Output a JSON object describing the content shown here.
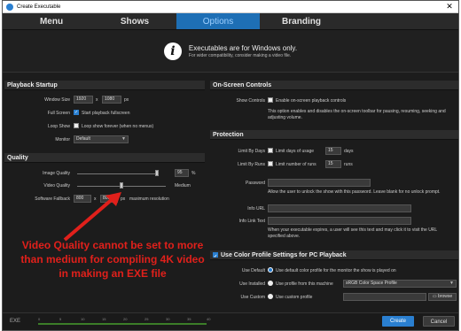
{
  "window": {
    "title": "Create Executable",
    "close": "✕"
  },
  "tabs": [
    {
      "label": "Menu",
      "active": false
    },
    {
      "label": "Shows",
      "active": false
    },
    {
      "label": "Options",
      "active": true
    },
    {
      "label": "Branding",
      "active": false
    }
  ],
  "info": {
    "main": "Executables are for Windows only.",
    "sub": "For wider compatibility, consider making a video file."
  },
  "playback": {
    "heading": "Playback Startup",
    "window_size_label": "Window Size",
    "width": "1920",
    "x1": "x",
    "height": "1080",
    "px": "px",
    "fullscreen_label": "Full Screen",
    "fullscreen_text": "Start playback fullscreen",
    "loop_label": "Loop Show",
    "loop_text": "Loop show forever (when no menus)",
    "monitor_label": "Monitor",
    "monitor_value": "Default"
  },
  "quality": {
    "heading": "Quality",
    "image_label": "Image Quality",
    "image_value": "95",
    "image_pct": "%",
    "video_label": "Video Quality",
    "video_value": "Medium",
    "fallback_label": "Software Fallback",
    "fallback_w": "800",
    "x2": "x",
    "fallback_h": "800",
    "fallback_px": "px",
    "fallback_text": "maximum resolution"
  },
  "osc": {
    "heading": "On-Screen Controls",
    "show_label": "Show Controls",
    "show_text": "Enable on-screen playback controls",
    "desc": "This option enables and disables the on-screen toolbar for pausing, resuming, seeking and adjusting volume."
  },
  "protection": {
    "heading": "Protection",
    "days_label": "Limit By Days",
    "days_text": "Limit days of usage",
    "days_value": "15",
    "days_unit": "days",
    "runs_label": "Limit By Runs",
    "runs_text": "Limit number of runs",
    "runs_value": "15",
    "runs_unit": "runs",
    "password_label": "Password",
    "password_help": "Allow the user to unlock the show with this password. Leave blank for no unlock prompt.",
    "info_url_label": "Info URL",
    "info_link_label": "Info Link Text",
    "info_help": "When your executable expires, a user will see this text and may click it to visit the URL specified above."
  },
  "color": {
    "heading": "Use Color Profile Settings for PC Playback",
    "default_label": "Use Default",
    "default_text": "Use default color profile for the monitor the show is played on",
    "installed_label": "Use Installed",
    "installed_text": "Use profile from this machine",
    "installed_value": "sRGB Color Space Profile",
    "custom_label": "Use Custom",
    "custom_text": "Use custom profile",
    "browse": "browse"
  },
  "annotation": {
    "text": "Video Quality cannot be set to more than medium for compiling 4K video in making an EXE file",
    "color": "#e0201b"
  },
  "footer": {
    "exe": "EXE",
    "ticks": [
      "0",
      "5",
      "10",
      "15",
      "20",
      "25",
      "30",
      "35",
      "40"
    ],
    "create": "Create",
    "cancel": "Cancel"
  },
  "colors": {
    "accent": "#1e6fb5",
    "bg": "#1c1c1c",
    "panel": "#2c2c2c",
    "meter": "#3c7d28"
  }
}
